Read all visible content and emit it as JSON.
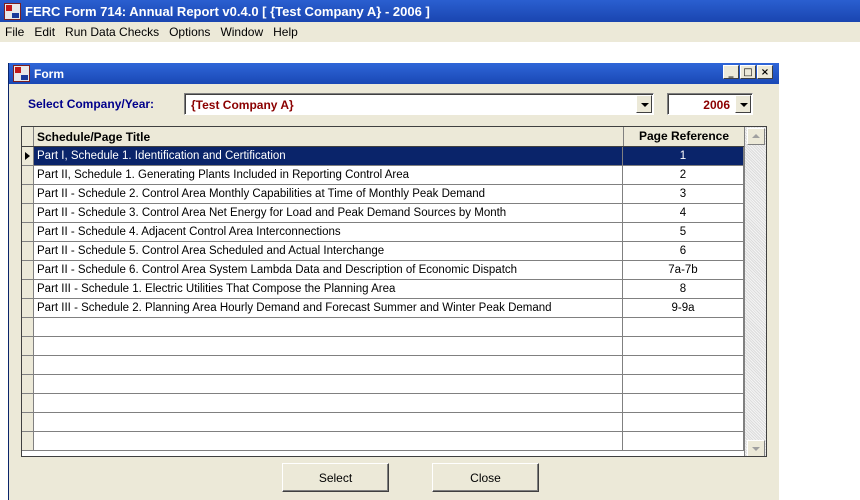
{
  "app": {
    "title": "FERC Form 714: Annual Report v0.4.0   [ {Test Company A} - 2006 ]"
  },
  "menu": [
    "File",
    "Edit",
    "Run Data Checks",
    "Options",
    "Window",
    "Help"
  ],
  "form": {
    "title": "Form",
    "select_label": "Select Company/Year:",
    "company_value": "{Test Company A}",
    "year_value": "2006",
    "grid": {
      "headers": [
        "Schedule/Page Title",
        "Page Reference"
      ],
      "selected_row": 0,
      "rows": [
        {
          "title": "Part I, Schedule 1. Identification and Certification",
          "page": "1"
        },
        {
          "title": "Part II, Schedule 1. Generating Plants Included in Reporting Control Area",
          "page": "2"
        },
        {
          "title": "Part II - Schedule 2.  Control Area Monthly Capabilities at Time of Monthly Peak Demand",
          "page": "3"
        },
        {
          "title": "Part II - Schedule 3. Control Area Net Energy for Load and Peak Demand Sources by Month",
          "page": "4"
        },
        {
          "title": "Part II - Schedule 4. Adjacent Control Area Interconnections",
          "page": "5"
        },
        {
          "title": "Part II - Schedule 5. Control Area Scheduled and Actual Interchange",
          "page": "6"
        },
        {
          "title": "Part II - Schedule 6. Control Area System Lambda Data and Description of Economic Dispatch",
          "page": "7a-7b"
        },
        {
          "title": "Part III - Schedule 1. Electric Utilities That Compose the Planning Area",
          "page": "8"
        },
        {
          "title": "Part III - Schedule 2. Planning Area Hourly Demand and Forecast Summer and Winter Peak Demand",
          "page": "9-9a"
        },
        {
          "title": "",
          "page": ""
        },
        {
          "title": "",
          "page": ""
        },
        {
          "title": "",
          "page": ""
        },
        {
          "title": "",
          "page": ""
        },
        {
          "title": "",
          "page": ""
        },
        {
          "title": "",
          "page": ""
        },
        {
          "title": "",
          "page": ""
        }
      ]
    },
    "buttons": {
      "select_label": "Select",
      "close_label": "Close"
    }
  }
}
